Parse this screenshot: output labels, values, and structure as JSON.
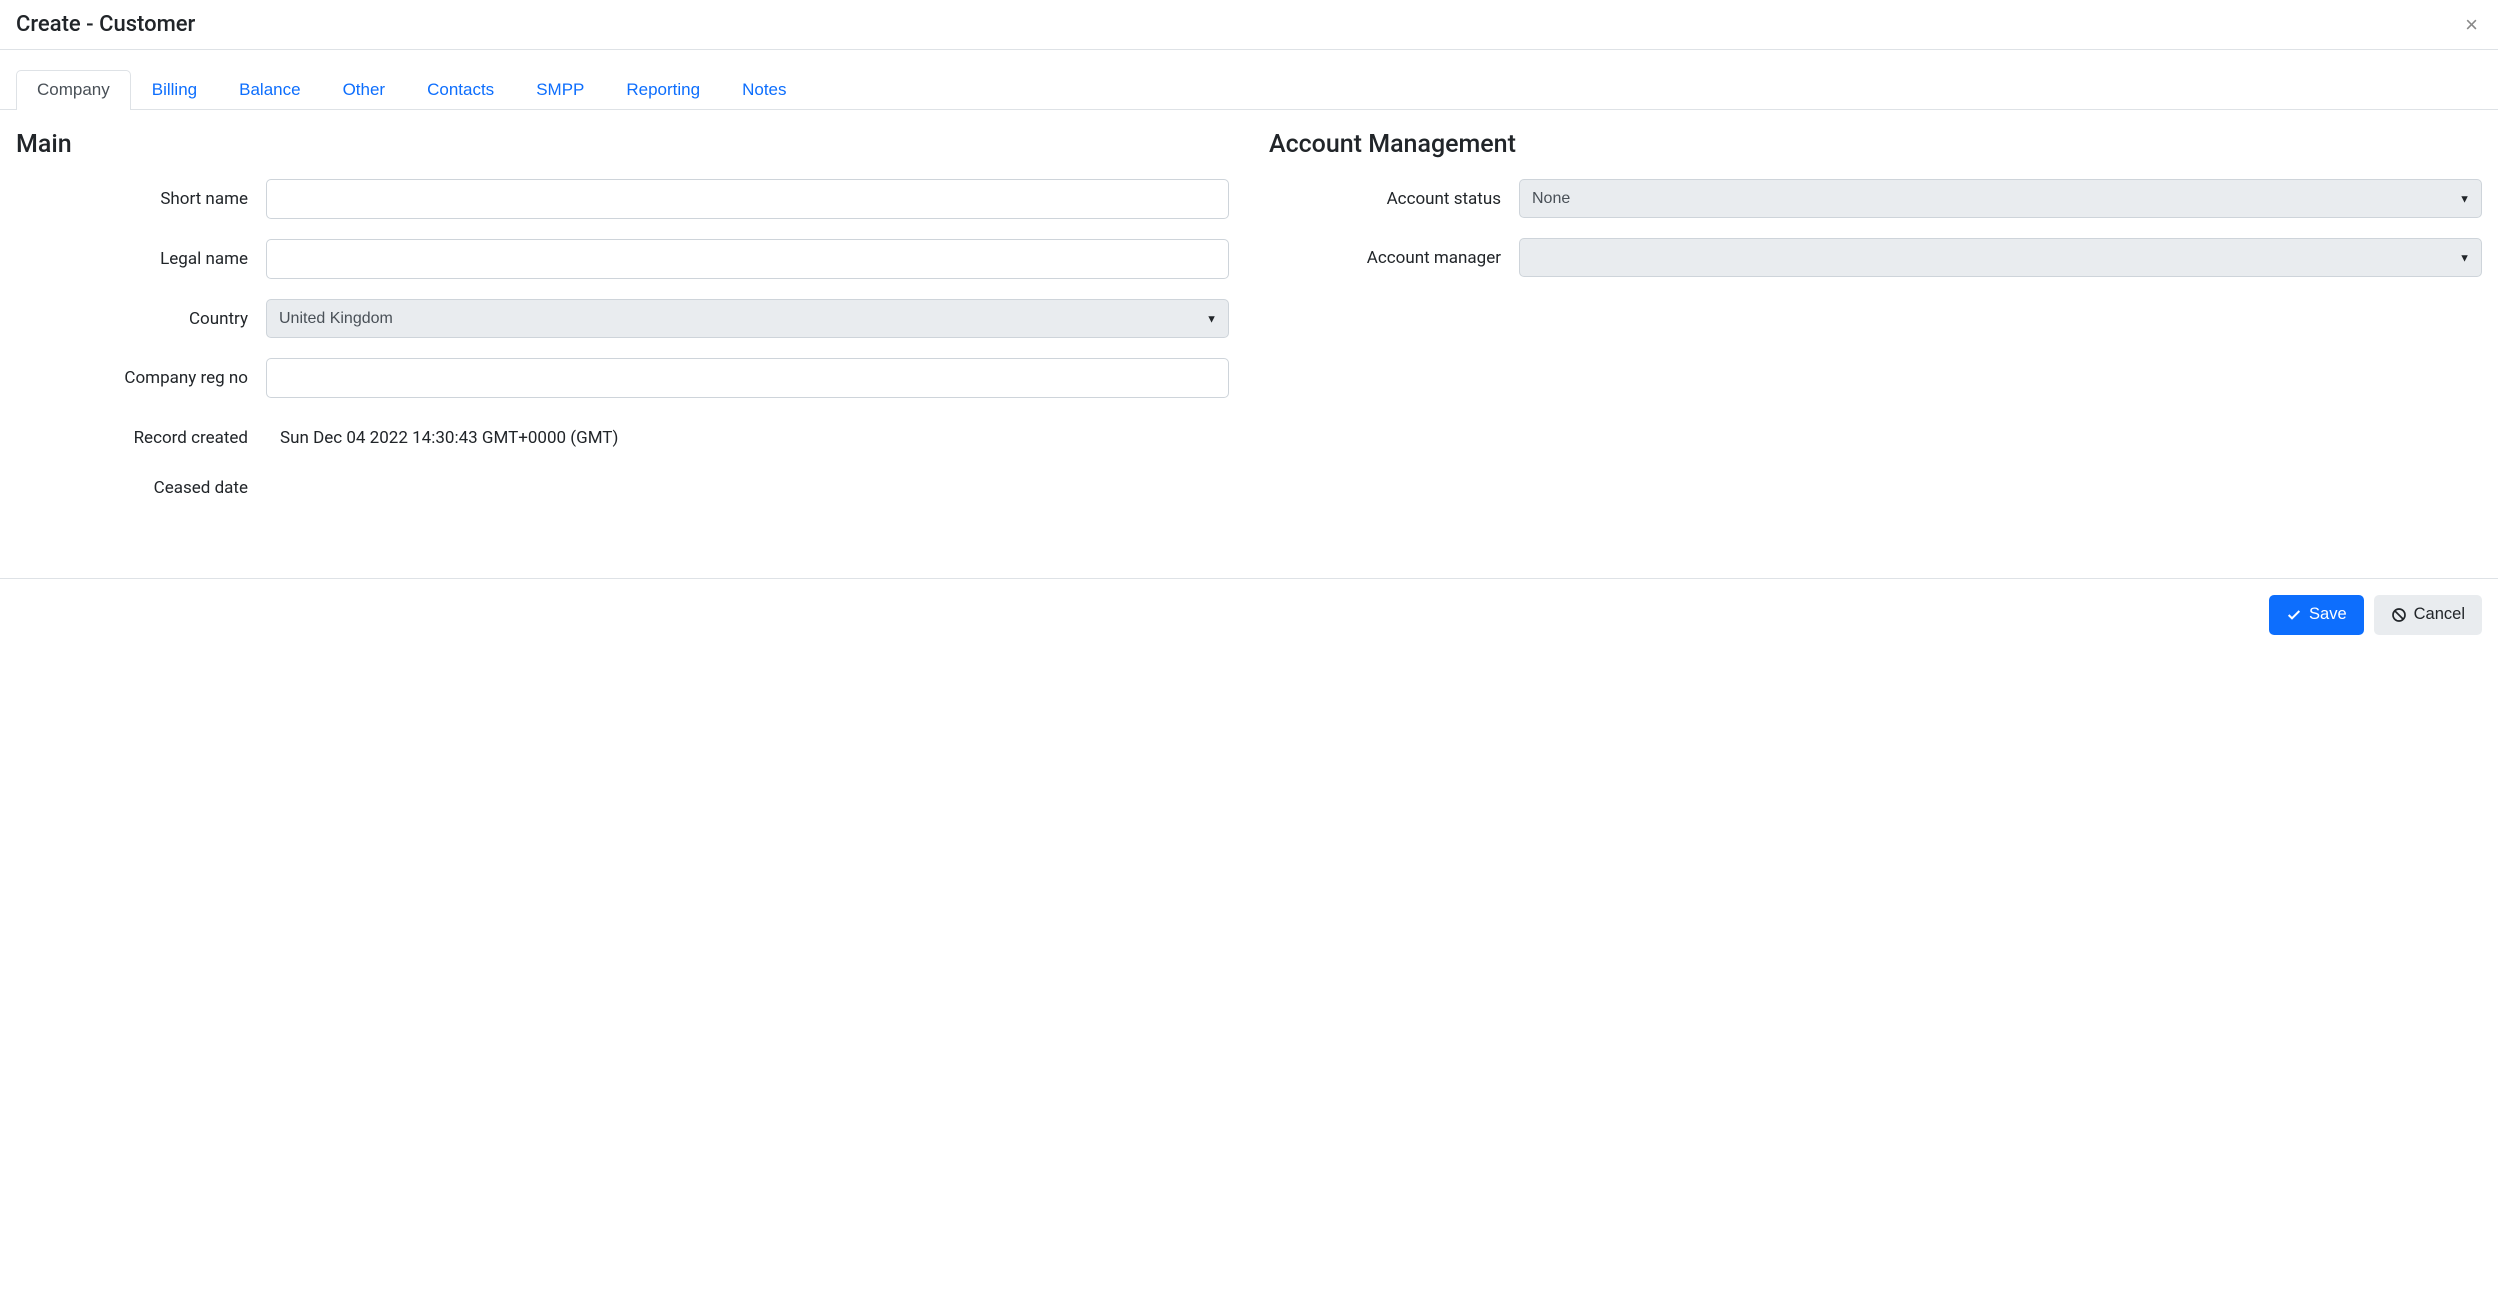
{
  "header": {
    "title": "Create - Customer"
  },
  "tabs": [
    {
      "label": "Company",
      "active": true
    },
    {
      "label": "Billing",
      "active": false
    },
    {
      "label": "Balance",
      "active": false
    },
    {
      "label": "Other",
      "active": false
    },
    {
      "label": "Contacts",
      "active": false
    },
    {
      "label": "SMPP",
      "active": false
    },
    {
      "label": "Reporting",
      "active": false
    },
    {
      "label": "Notes",
      "active": false
    }
  ],
  "main": {
    "section_title": "Main",
    "fields": {
      "short_name": {
        "label": "Short name",
        "value": ""
      },
      "legal_name": {
        "label": "Legal name",
        "value": ""
      },
      "country": {
        "label": "Country",
        "value": "United Kingdom"
      },
      "company_reg_no": {
        "label": "Company reg no",
        "value": ""
      },
      "record_created": {
        "label": "Record created",
        "value": "Sun Dec 04 2022 14:30:43 GMT+0000 (GMT)"
      },
      "ceased_date": {
        "label": "Ceased date",
        "value": ""
      }
    }
  },
  "account": {
    "section_title": "Account Management",
    "fields": {
      "account_status": {
        "label": "Account status",
        "value": "None"
      },
      "account_manager": {
        "label": "Account manager",
        "value": ""
      }
    }
  },
  "footer": {
    "save_label": "Save",
    "cancel_label": "Cancel"
  }
}
